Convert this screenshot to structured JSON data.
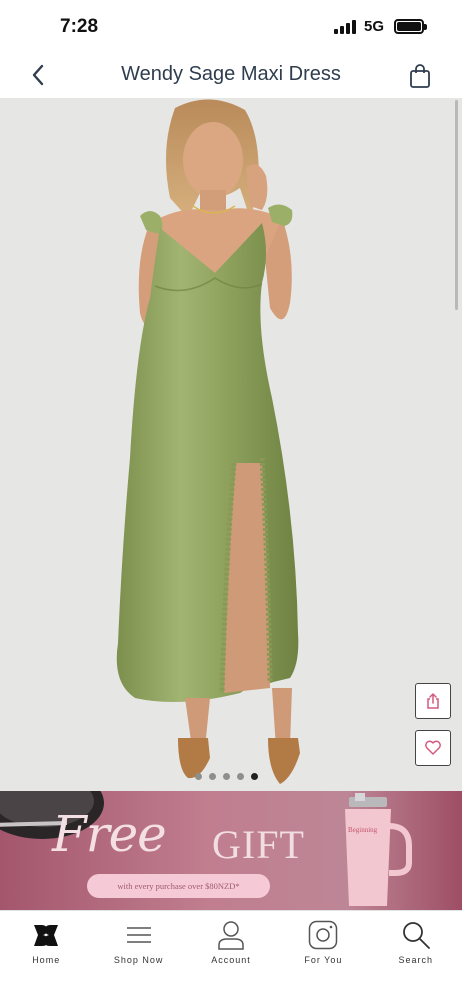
{
  "status_bar": {
    "time": "7:28",
    "network": "5G",
    "battery_level": 1.0
  },
  "header": {
    "title": "Wendy Sage Maxi Dress",
    "back_icon": "chevron-left-icon",
    "bag_icon": "shopping-bag-icon"
  },
  "gallery": {
    "image_count": 5,
    "active_index": 4,
    "dress_color": "#8ea25e",
    "background_color": "#e6e7e4"
  },
  "actions": {
    "share_icon": "share-icon",
    "wishlist_icon": "heart-icon",
    "accent_color": "#d45a7e"
  },
  "promo": {
    "free_text": "Free",
    "gift_text": "GIFT",
    "subtext": "with every purchase over $80NZD*",
    "brand_text": "Beginning"
  },
  "bottom_nav": {
    "items": [
      {
        "label": "Home",
        "icon": "brand-logo-icon"
      },
      {
        "label": "Shop Now",
        "icon": "menu-icon"
      },
      {
        "label": "Account",
        "icon": "person-icon"
      },
      {
        "label": "For You",
        "icon": "instagram-icon"
      },
      {
        "label": "Search",
        "icon": "search-icon"
      }
    ]
  }
}
